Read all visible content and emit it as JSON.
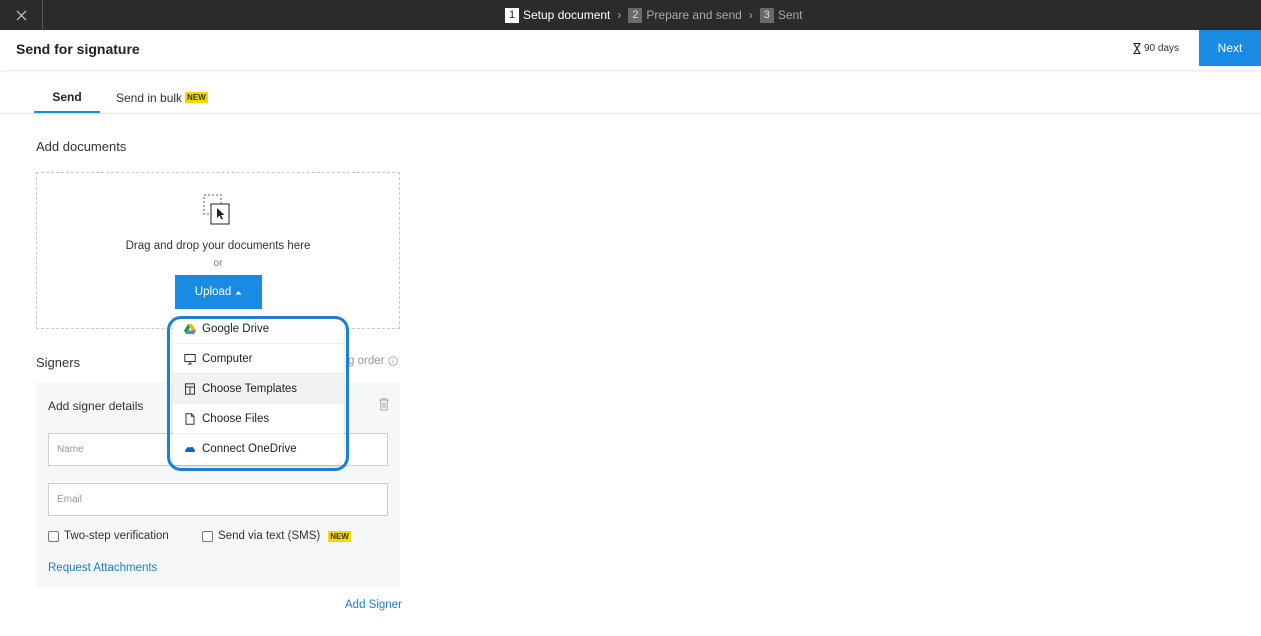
{
  "steps": [
    {
      "num": "1",
      "label": "Setup document"
    },
    {
      "num": "2",
      "label": "Prepare and send"
    },
    {
      "num": "3",
      "label": "Sent"
    }
  ],
  "header": {
    "title": "Send for signature",
    "expiry": "90 days",
    "next_label": "Next"
  },
  "tabs": {
    "send": "Send",
    "bulk": "Send in bulk",
    "new_badge": "NEW"
  },
  "documents": {
    "title": "Add documents",
    "drop_text": "Drag and drop your documents here",
    "or": "or",
    "upload_label": "Upload"
  },
  "upload_menu": [
    {
      "label": "Google Drive",
      "icon": "google-drive-icon"
    },
    {
      "label": "Computer",
      "icon": "monitor-icon"
    },
    {
      "label": "Choose Templates",
      "icon": "template-icon"
    },
    {
      "label": "Choose Files",
      "icon": "file-icon"
    },
    {
      "label": "Connect OneDrive",
      "icon": "onedrive-icon"
    }
  ],
  "signers": {
    "title": "Signers",
    "signing_order_partial": "g order",
    "card_title": "Add signer details",
    "name_placeholder": "Name",
    "email_placeholder": "Email",
    "two_step": "Two-step verification",
    "sms": "Send via text (SMS)",
    "sms_badge": "NEW",
    "request_attachments": "Request Attachments",
    "add_signer": "Add Signer"
  },
  "colors": {
    "accent": "#1a8be3",
    "badge": "#f5d800",
    "highlight": "#1c7fd4"
  }
}
